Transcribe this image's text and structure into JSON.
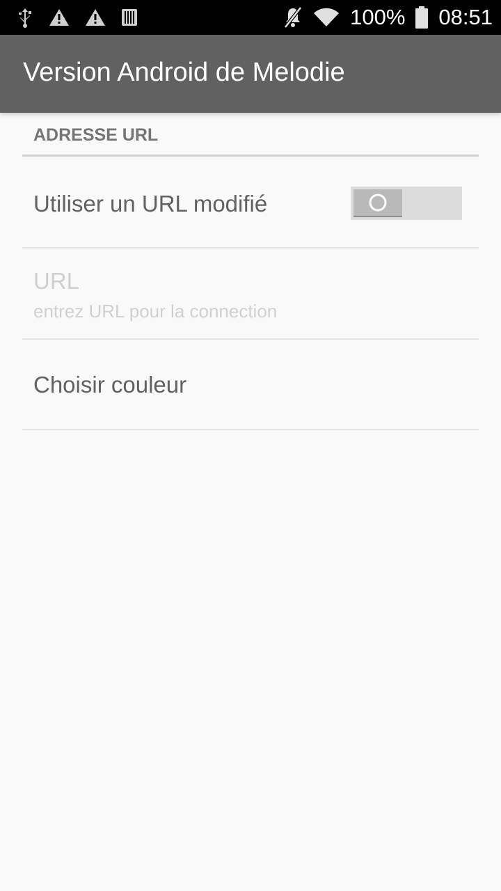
{
  "status_bar": {
    "icons_left": [
      "usb-icon",
      "warning-icon",
      "warning-icon",
      "barcode-icon"
    ],
    "icons_right": [
      "mute-icon",
      "wifi-icon",
      "battery-icon"
    ],
    "battery": "100%",
    "time": "08:51"
  },
  "app_bar": {
    "title": "Version Android de Melodie"
  },
  "preferences": {
    "category_title": "ADRESSE URL",
    "custom_url": {
      "title": "Utiliser un URL modifié",
      "toggle_state": "off"
    },
    "url": {
      "title": "URL",
      "summary": "entrez URL pour la connection"
    },
    "color": {
      "title": "Choisir couleur"
    }
  },
  "colors": {
    "status_bar_bg": "#000000",
    "app_bar_bg": "#616161",
    "page_bg": "#f9f9f9"
  }
}
